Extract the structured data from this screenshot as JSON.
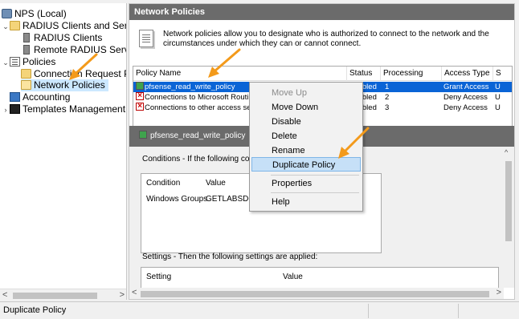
{
  "tree": {
    "root": "NPS (Local)",
    "radius_clients_servers": "RADIUS Clients and Servers",
    "radius_clients": "RADIUS Clients",
    "remote_radius_server": "Remote RADIUS Server",
    "policies": "Policies",
    "connection_request": "Connection Request Po",
    "network_policies": "Network Policies",
    "accounting": "Accounting",
    "templates_management": "Templates Management"
  },
  "pane": {
    "title": "Network Policies",
    "description": "Network policies allow you to designate who is authorized to connect to the network and the circumstances under which they can or cannot connect."
  },
  "policy_table": {
    "columns": [
      "Policy Name",
      "Status",
      "Processing Order",
      "Access Type",
      "S"
    ],
    "rows": [
      {
        "name": "pfsense_read_write_policy",
        "status": "Enabled",
        "order": "1",
        "access": "Grant Access",
        "s": "U"
      },
      {
        "name": "Connections to Microsoft Routing",
        "status": "Enabled",
        "order": "2",
        "access": "Deny Access",
        "s": "U"
      },
      {
        "name": "Connections to other access serv",
        "status": "Enabled",
        "order": "3",
        "access": "Deny Access",
        "s": "U"
      }
    ]
  },
  "selected_policy": "pfsense_read_write_policy",
  "conditions": {
    "title": "Conditions - If the following conditi",
    "header_condition": "Condition",
    "header_value": "Value",
    "condition": "Windows Groups",
    "value": "GETLABSDO"
  },
  "settings": {
    "title": "Settings - Then the following settings are applied:",
    "header_setting": "Setting",
    "header_value": "Value"
  },
  "context_menu": {
    "move_up": "Move Up",
    "move_down": "Move Down",
    "disable": "Disable",
    "delete": "Delete",
    "rename": "Rename",
    "duplicate": "Duplicate Policy",
    "properties": "Properties",
    "help": "Help"
  },
  "statusbar": {
    "text": "Duplicate Policy"
  },
  "colors": {
    "header_bg": "#6b6b6b",
    "selection": "#0a64d6",
    "menu_highlight": "#c6e0f7",
    "arrow": "#f39a1b"
  }
}
